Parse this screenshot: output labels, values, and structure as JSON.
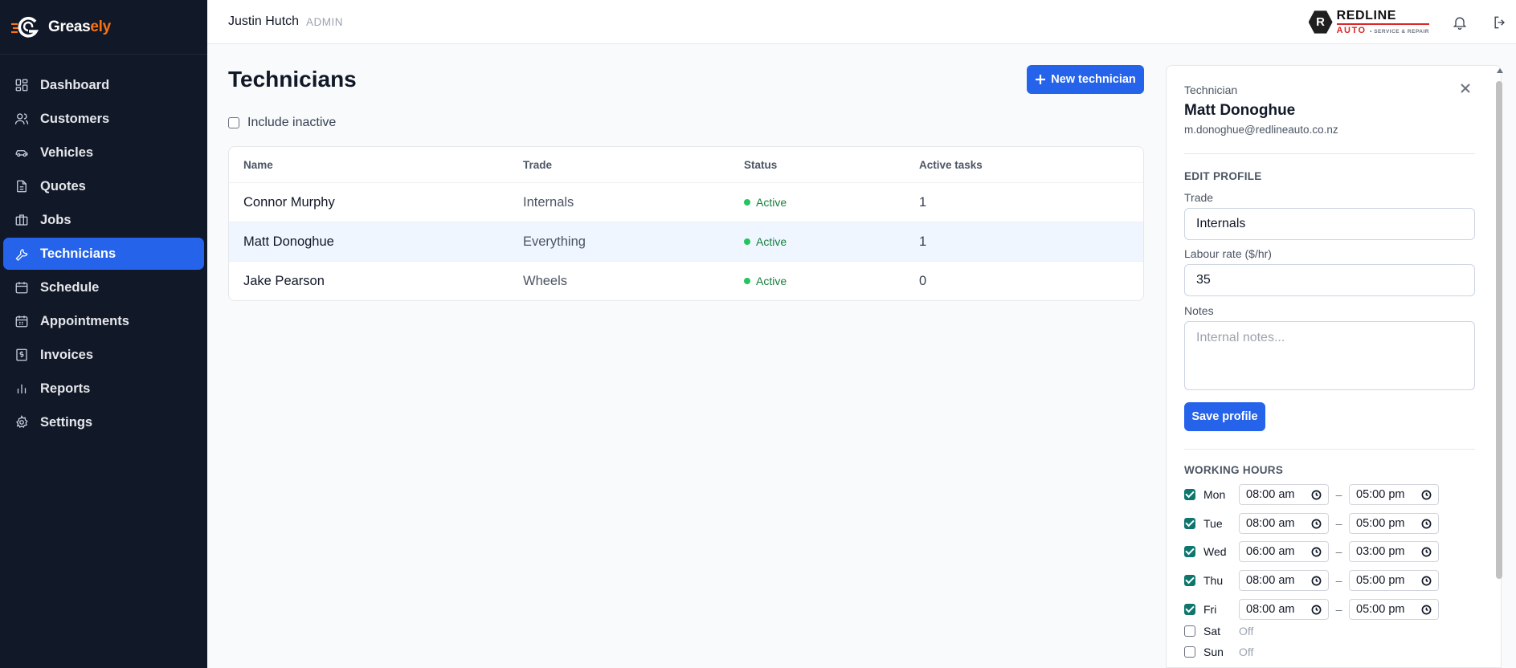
{
  "brand": {
    "name_main": "Greas",
    "name_accent": "ely",
    "icon": "greasely-logo-icon"
  },
  "sidebar": {
    "items": [
      {
        "label": "Dashboard",
        "icon": "grid-icon",
        "active": false
      },
      {
        "label": "Customers",
        "icon": "users-icon",
        "active": false
      },
      {
        "label": "Vehicles",
        "icon": "car-icon",
        "active": false
      },
      {
        "label": "Quotes",
        "icon": "document-icon",
        "active": false
      },
      {
        "label": "Jobs",
        "icon": "briefcase-icon",
        "active": false
      },
      {
        "label": "Technicians",
        "icon": "wrench-icon",
        "active": true
      },
      {
        "label": "Schedule",
        "icon": "calendar-icon",
        "active": false
      },
      {
        "label": "Appointments",
        "icon": "calendar-check-icon",
        "active": false
      },
      {
        "label": "Invoices",
        "icon": "invoice-dollar-icon",
        "active": false
      },
      {
        "label": "Reports",
        "icon": "bar-chart-icon",
        "active": false
      },
      {
        "label": "Settings",
        "icon": "gear-icon",
        "active": false
      }
    ]
  },
  "header": {
    "user_name": "Justin Hutch",
    "user_role": "ADMIN",
    "company_logo": {
      "badge_letter": "R",
      "top": "REDLINE",
      "bottom": "AUTO",
      "tagline": "• SERVICE & REPAIR"
    }
  },
  "main": {
    "title": "Technicians",
    "new_button_label": "New technician",
    "include_inactive_label": "Include inactive",
    "include_inactive_checked": false,
    "table": {
      "columns": [
        "Name",
        "Trade",
        "Status",
        "Active tasks"
      ],
      "rows": [
        {
          "name": "Connor Murphy",
          "trade": "Internals",
          "status": "Active",
          "active_tasks": "1",
          "selected": false
        },
        {
          "name": "Matt Donoghue",
          "trade": "Everything",
          "status": "Active",
          "active_tasks": "1",
          "selected": true
        },
        {
          "name": "Jake Pearson",
          "trade": "Wheels",
          "status": "Active",
          "active_tasks": "0",
          "selected": false
        }
      ]
    }
  },
  "panel": {
    "label": "Technician",
    "name": "Matt Donoghue",
    "email": "m.donoghue@redlineauto.co.nz",
    "edit_title": "EDIT PROFILE",
    "trade_label": "Trade",
    "trade_value": "Internals",
    "rate_label": "Labour rate ($/hr)",
    "rate_value": "35",
    "notes_label": "Notes",
    "notes_placeholder": "Internal notes...",
    "save_label": "Save profile",
    "hours_title": "WORKING HOURS",
    "hours": [
      {
        "day": "Mon",
        "enabled": true,
        "start": "08:00 am",
        "end": "05:00 pm"
      },
      {
        "day": "Tue",
        "enabled": true,
        "start": "08:00 am",
        "end": "05:00 pm"
      },
      {
        "day": "Wed",
        "enabled": true,
        "start": "06:00 am",
        "end": "03:00 pm"
      },
      {
        "day": "Thu",
        "enabled": true,
        "start": "08:00 am",
        "end": "05:00 pm"
      },
      {
        "day": "Fri",
        "enabled": true,
        "start": "08:00 am",
        "end": "05:00 pm"
      },
      {
        "day": "Sat",
        "enabled": false,
        "off_label": "Off"
      },
      {
        "day": "Sun",
        "enabled": false,
        "off_label": "Off"
      }
    ],
    "dash": "–"
  },
  "colors": {
    "accent": "#2563eb",
    "sidebar_bg": "#111827",
    "brand_orange": "#f97316",
    "status_green": "#22c55e",
    "checkbox": "#0f766e"
  }
}
